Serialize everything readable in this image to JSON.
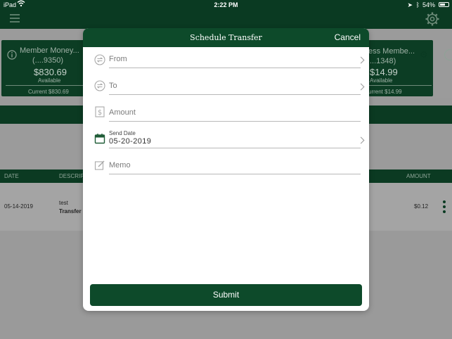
{
  "status_bar": {
    "device": "iPad",
    "time": "2:22 PM",
    "battery": "54%"
  },
  "background": {
    "cards": [
      {
        "name": "Member Money...",
        "number": "(....9350)",
        "balance": "$830.69",
        "available_label": "Available",
        "current": "Current $830.69"
      },
      {
        "name": "ess Membe...",
        "number": "...1348)",
        "balance": "$14.99",
        "available_label": "Available",
        "current": "urrent $14.99"
      }
    ],
    "table": {
      "headers": [
        "DATE",
        "DESCRIP",
        "AMOUNT"
      ],
      "rows": [
        {
          "date": "05-14-2019",
          "desc": "test",
          "type": "Transfer",
          "amount": "$0.12"
        }
      ]
    }
  },
  "modal": {
    "title": "Schedule Transfer",
    "cancel": "Cancel",
    "fields": {
      "from": {
        "label": "From"
      },
      "to": {
        "label": "To"
      },
      "amount": {
        "label": "Amount"
      },
      "send_date": {
        "label": "Send Date",
        "value": "05-20-2019"
      },
      "memo": {
        "label": "Memo"
      }
    },
    "submit": "Submit"
  },
  "colors": {
    "primary_green": "#0d4a2a",
    "dark_green": "#0a3a22",
    "overlay_gray": "#9a9a9a"
  }
}
